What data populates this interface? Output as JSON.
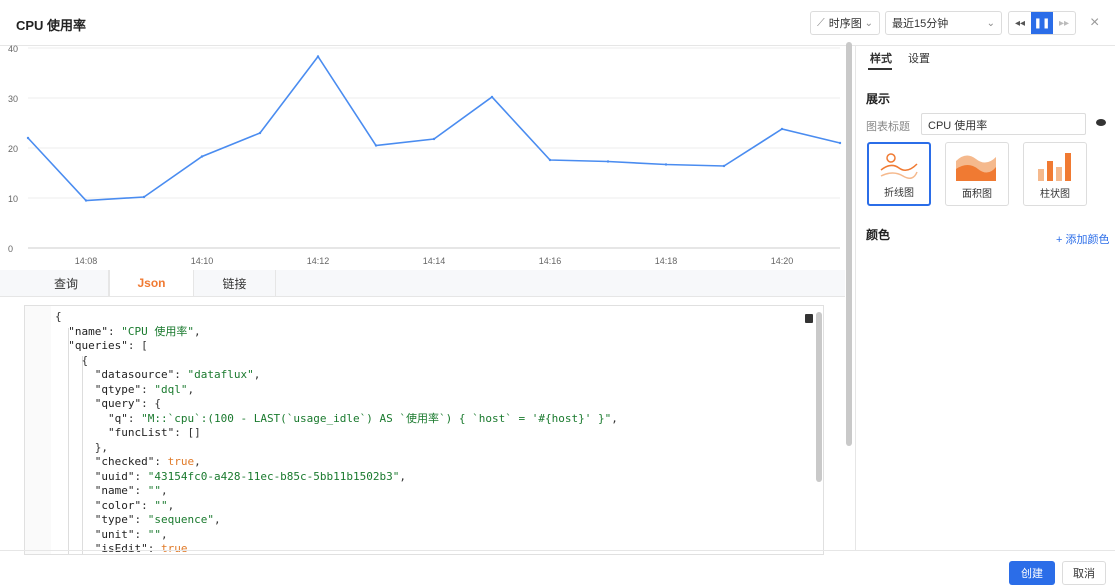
{
  "header": {
    "title": "CPU 使用率",
    "chart_type": "时序图",
    "time_range": "最近15分钟",
    "controls": {
      "prev": "◂◂",
      "pause": "❚❚",
      "next": "▸▸"
    },
    "close": "×"
  },
  "chart_data": {
    "type": "line",
    "x": [
      "14:07",
      "14:08",
      "14:09",
      "14:10",
      "14:11",
      "14:12",
      "14:13",
      "14:14",
      "14:15",
      "14:16",
      "14:17",
      "14:18",
      "14:19",
      "14:20",
      "14:21"
    ],
    "xticks": [
      "14:08",
      "14:10",
      "14:12",
      "14:14",
      "14:16",
      "14:18",
      "14:20"
    ],
    "yticks": [
      "0",
      "10",
      "20",
      "30",
      "40"
    ],
    "series": [
      {
        "values": [
          22,
          9.5,
          10.2,
          18.3,
          23,
          38.3,
          20.5,
          21.8,
          30.2,
          17.6,
          17.3,
          16.7,
          16.4,
          23.8,
          21
        ]
      }
    ],
    "ylim": [
      0,
      40
    ],
    "grid": true,
    "color": "#4a8cf0"
  },
  "editor_tabs": [
    "查询",
    "Json",
    "链接"
  ],
  "json_lines": [
    [
      [
        "p",
        "{"
      ]
    ],
    [
      [
        "k",
        "  \"name\""
      ],
      [
        "p",
        ": "
      ],
      [
        "s",
        "\"CPU 使用率\""
      ],
      [
        "p",
        ","
      ]
    ],
    [
      [
        "k",
        "  \"queries\""
      ],
      [
        "p",
        ": ["
      ]
    ],
    [
      [
        "p",
        "    {"
      ]
    ],
    [
      [
        "k",
        "      \"datasource\""
      ],
      [
        "p",
        ": "
      ],
      [
        "s",
        "\"dataflux\""
      ],
      [
        "p",
        ","
      ]
    ],
    [
      [
        "k",
        "      \"qtype\""
      ],
      [
        "p",
        ": "
      ],
      [
        "s",
        "\"dql\""
      ],
      [
        "p",
        ","
      ]
    ],
    [
      [
        "k",
        "      \"query\""
      ],
      [
        "p",
        ": {"
      ]
    ],
    [
      [
        "k",
        "        \"q\""
      ],
      [
        "p",
        ": "
      ],
      [
        "s",
        "\"M::`cpu`:(100 - LAST(`usage_idle`) AS `使用率`) { `host` = '#{host}' }\""
      ],
      [
        "p",
        ","
      ]
    ],
    [
      [
        "k",
        "        \"funcList\""
      ],
      [
        "p",
        ": []"
      ]
    ],
    [
      [
        "p",
        "      },"
      ]
    ],
    [
      [
        "k",
        "      \"checked\""
      ],
      [
        "p",
        ": "
      ],
      [
        "b",
        "true"
      ],
      [
        "p",
        ","
      ]
    ],
    [
      [
        "k",
        "      \"uuid\""
      ],
      [
        "p",
        ": "
      ],
      [
        "s",
        "\"43154fc0-a428-11ec-b85c-5bb11b1502b3\""
      ],
      [
        "p",
        ","
      ]
    ],
    [
      [
        "k",
        "      \"name\""
      ],
      [
        "p",
        ": "
      ],
      [
        "s",
        "\"\""
      ],
      [
        "p",
        ","
      ]
    ],
    [
      [
        "k",
        "      \"color\""
      ],
      [
        "p",
        ": "
      ],
      [
        "s",
        "\"\""
      ],
      [
        "p",
        ","
      ]
    ],
    [
      [
        "k",
        "      \"type\""
      ],
      [
        "p",
        ": "
      ],
      [
        "s",
        "\"sequence\""
      ],
      [
        "p",
        ","
      ]
    ],
    [
      [
        "k",
        "      \"unit\""
      ],
      [
        "p",
        ": "
      ],
      [
        "s",
        "\"\""
      ],
      [
        "p",
        ","
      ]
    ],
    [
      [
        "k",
        "      \"isEdit\""
      ],
      [
        "p",
        ": "
      ],
      [
        "b",
        "true"
      ]
    ]
  ],
  "panel": {
    "tabs": [
      "样式",
      "设置"
    ],
    "display_section": "展示",
    "chart_title_label": "图表标题",
    "chart_title_value": "CPU 使用率",
    "styles": [
      "折线图",
      "面积图",
      "柱状图"
    ],
    "color_section": "颜色",
    "add_color": "+ 添加颜色"
  },
  "footer": {
    "create": "创建",
    "cancel": "取消"
  }
}
